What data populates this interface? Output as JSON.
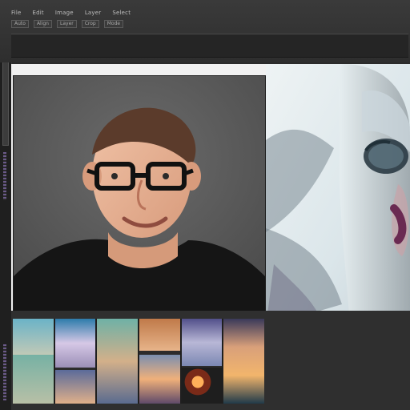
{
  "menu": {
    "items": [
      {
        "label": "File"
      },
      {
        "label": "Edit"
      },
      {
        "label": "Image"
      },
      {
        "label": "Layer"
      },
      {
        "label": "Select"
      }
    ]
  },
  "toolbar": {
    "buttons": [
      {
        "label": "Auto"
      },
      {
        "label": "Align"
      },
      {
        "label": "Layer"
      },
      {
        "label": "Crop"
      },
      {
        "label": "Mode"
      }
    ]
  },
  "gallery": {
    "thumb_count": 6
  }
}
